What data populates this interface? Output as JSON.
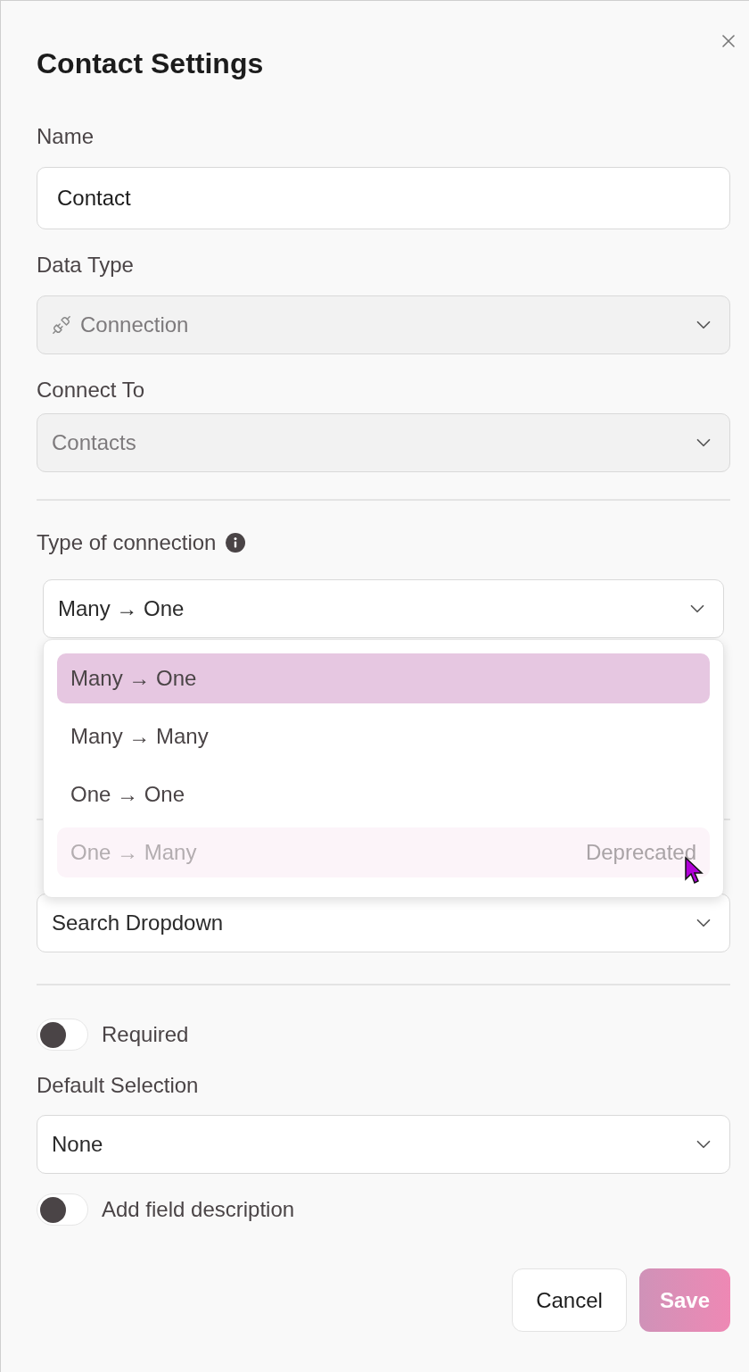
{
  "title": "Contact Settings",
  "name": {
    "label": "Name",
    "value": "Contact"
  },
  "data_type": {
    "label": "Data Type",
    "value": "Connection",
    "disabled": true
  },
  "connect_to": {
    "label": "Connect To",
    "value": "Contacts",
    "disabled": true
  },
  "connection_type": {
    "label": "Type of connection",
    "value": "Many → One",
    "options": [
      {
        "label": "Many → One",
        "selected": true,
        "disabled": false
      },
      {
        "label": "Many → Many",
        "selected": false,
        "disabled": false
      },
      {
        "label": "One → One",
        "selected": false,
        "disabled": false
      },
      {
        "label": "One → Many",
        "selected": false,
        "disabled": true,
        "note": "Deprecated"
      }
    ]
  },
  "display": {
    "value": "Search Dropdown"
  },
  "required": {
    "label": "Required",
    "on": false
  },
  "default_selection": {
    "label": "Default Selection",
    "value": "None"
  },
  "description": {
    "label": "Add field description",
    "on": false
  },
  "buttons": [
    {
      "label": "Cancel",
      "kind": "secondary"
    },
    {
      "label": "Save",
      "kind": "primary"
    }
  ]
}
